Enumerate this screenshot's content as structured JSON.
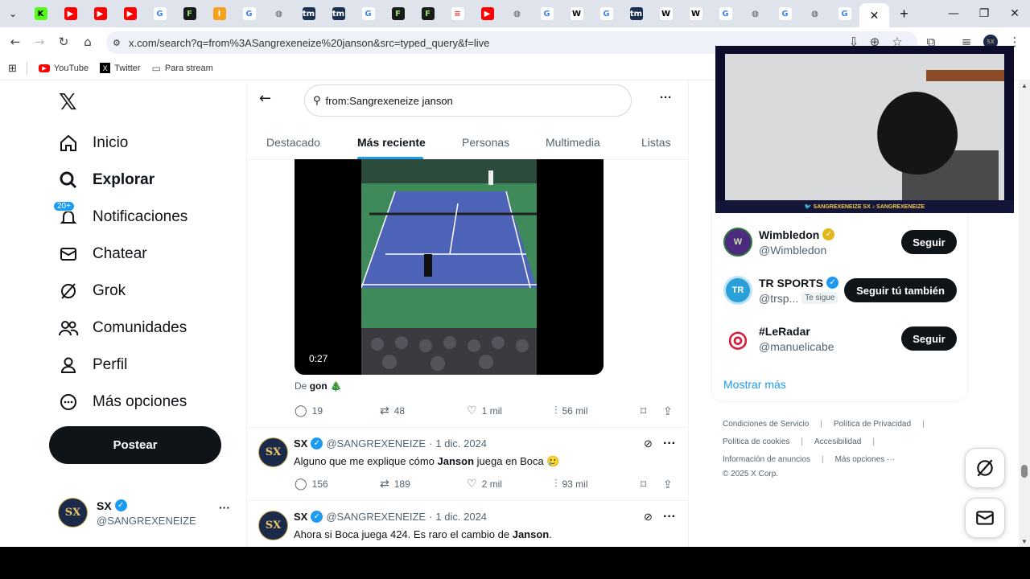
{
  "browser": {
    "favicons": [
      {
        "name": "tab-kick",
        "glyph": "K",
        "color": "#53fc18",
        "text": "#000"
      },
      {
        "name": "tab-youtube-1",
        "glyph": "▶",
        "color": "#ff0000",
        "text": "#fff"
      },
      {
        "name": "tab-youtube-2",
        "glyph": "▶",
        "color": "#ff0000",
        "text": "#fff"
      },
      {
        "name": "tab-youtube-3",
        "glyph": "▶",
        "color": "#ff0000",
        "text": "#fff"
      },
      {
        "name": "tab-google-1",
        "glyph": "G",
        "color": "#ffffff",
        "text": "#4285f4"
      },
      {
        "name": "tab-fotmob-1",
        "glyph": "F",
        "color": "#1a1a1a",
        "text": "#8fe36b"
      },
      {
        "name": "tab-orange-1",
        "glyph": "I",
        "color": "#f7a11a",
        "text": "#fff"
      },
      {
        "name": "tab-google-2",
        "glyph": "G",
        "color": "#ffffff",
        "text": "#4285f4"
      },
      {
        "name": "tab-globe-1",
        "glyph": "◍",
        "color": "#dfe3eb",
        "text": "#555"
      },
      {
        "name": "tab-tm-1",
        "glyph": "tm",
        "color": "#1a3151",
        "text": "#fff"
      },
      {
        "name": "tab-tm-2",
        "glyph": "tm",
        "color": "#1a3151",
        "text": "#fff"
      },
      {
        "name": "tab-google-3",
        "glyph": "G",
        "color": "#ffffff",
        "text": "#4285f4"
      },
      {
        "name": "tab-fotmob-2",
        "glyph": "F",
        "color": "#1a1a1a",
        "text": "#8fe36b"
      },
      {
        "name": "tab-fotmob-3",
        "glyph": "F",
        "color": "#1a1a1a",
        "text": "#8fe36b"
      },
      {
        "name": "tab-news-1",
        "glyph": "≡",
        "color": "#ffffff",
        "text": "#d33"
      },
      {
        "name": "tab-youtube-4",
        "glyph": "▶",
        "color": "#ff0000",
        "text": "#fff"
      },
      {
        "name": "tab-globe-2",
        "glyph": "◍",
        "color": "#dfe3eb",
        "text": "#555"
      },
      {
        "name": "tab-google-4",
        "glyph": "G",
        "color": "#ffffff",
        "text": "#4285f4"
      },
      {
        "name": "tab-wiki-1",
        "glyph": "W",
        "color": "#ffffff",
        "text": "#000"
      },
      {
        "name": "tab-google-5",
        "glyph": "G",
        "color": "#ffffff",
        "text": "#4285f4"
      },
      {
        "name": "tab-tm-3",
        "glyph": "tm",
        "color": "#1a3151",
        "text": "#fff"
      },
      {
        "name": "tab-wiki-2",
        "glyph": "W",
        "color": "#ffffff",
        "text": "#000"
      },
      {
        "name": "tab-wiki-3",
        "glyph": "W",
        "color": "#ffffff",
        "text": "#000"
      },
      {
        "name": "tab-google-6",
        "glyph": "G",
        "color": "#ffffff",
        "text": "#4285f4"
      },
      {
        "name": "tab-globe-3",
        "glyph": "◍",
        "color": "#dfe3eb",
        "text": "#555"
      },
      {
        "name": "tab-google-7",
        "glyph": "G",
        "color": "#ffffff",
        "text": "#4285f4"
      },
      {
        "name": "tab-globe-4",
        "glyph": "◍",
        "color": "#dfe3eb",
        "text": "#555"
      },
      {
        "name": "tab-google-8",
        "glyph": "G",
        "color": "#ffffff",
        "text": "#4285f4"
      }
    ],
    "url": "x.com/search?q=from%3ASangrexeneize%20janson&src=typed_query&f=live",
    "bookmarks": [
      {
        "label": "YouTube",
        "icon": "youtube-icon"
      },
      {
        "label": "Twitter",
        "icon": "x-icon"
      },
      {
        "label": "Para stream",
        "icon": "folder-icon"
      }
    ]
  },
  "nav": {
    "items": [
      {
        "label": "Inicio",
        "icon": "home-icon"
      },
      {
        "label": "Explorar",
        "icon": "search-icon"
      },
      {
        "label": "Notificaciones",
        "icon": "bell-icon",
        "badge": "20+"
      },
      {
        "label": "Chatear",
        "icon": "mail-icon"
      },
      {
        "label": "Grok",
        "icon": "grok-icon"
      },
      {
        "label": "Comunidades",
        "icon": "people-icon"
      },
      {
        "label": "Perfil",
        "icon": "person-icon"
      },
      {
        "label": "Más opciones",
        "icon": "more-circle-icon"
      }
    ],
    "post_label": "Postear",
    "account": {
      "name": "SX",
      "handle": "@SANGREXENEIZE",
      "avatar": "SX"
    }
  },
  "search": {
    "query": "from:Sangrexeneize janson",
    "tabs": [
      "Destacado",
      "Más reciente",
      "Personas",
      "Multimedia",
      "Listas"
    ],
    "active_tab": "Más reciente"
  },
  "video_post": {
    "duration": "0:27",
    "credit_prefix": "De",
    "credit_name": "gon",
    "credit_emoji": "🎄",
    "stats": {
      "replies": "19",
      "reposts": "48",
      "likes": "1 mil",
      "views": "56 mil"
    }
  },
  "tweets": [
    {
      "name": "SX",
      "handle": "@SANGREXENEIZE",
      "date": "1 dic. 2024",
      "text_before": "Alguno que me explique cómo ",
      "highlight": "Janson",
      "text_after": " juega en Boca 🥲",
      "stats": {
        "replies": "156",
        "reposts": "189",
        "likes": "2 mil",
        "views": "93 mil"
      }
    },
    {
      "name": "SX",
      "handle": "@SANGREXENEIZE",
      "date": "1 dic. 2024",
      "text_before": "Ahora si Boca juega 424. Es raro el cambio de ",
      "highlight": "Janson",
      "text_after": "."
    }
  ],
  "who_to_follow": [
    {
      "name": "Wimbledon",
      "handle": "@Wimbledon",
      "verified": "gold",
      "button": "Seguir",
      "avatar_color": "#4b2a80",
      "avatar_text": "W"
    },
    {
      "name": "TR SPORTS",
      "handle": "@trsp...",
      "verified": "blue",
      "follows_you": "Te sigue",
      "button": "Seguir tú también",
      "avatar_color": "#2aa0d8",
      "avatar_text": "TR"
    },
    {
      "name": "#LeRadar",
      "handle": "@manuelicabe",
      "verified": "",
      "button": "Seguir",
      "avatar_color": "#ffffff",
      "avatar_text": "◎"
    }
  ],
  "show_more": "Mostrar más",
  "footer": {
    "line1": [
      "Condiciones de Servicio",
      "Política de Privacidad"
    ],
    "line2": [
      "Política de cookies",
      "Accesibilidad"
    ],
    "line3": [
      "Información de anuncios",
      "Más opciones ···"
    ],
    "copyright": "© 2025 X Corp."
  },
  "webcam": {
    "band_text": "🐦 SANGREXENEIZE    SX    ♪ SANGREXENEIZE"
  },
  "colors": {
    "accent": "#1d9bf0",
    "text_primary": "#0f1419",
    "text_secondary": "#536471"
  }
}
